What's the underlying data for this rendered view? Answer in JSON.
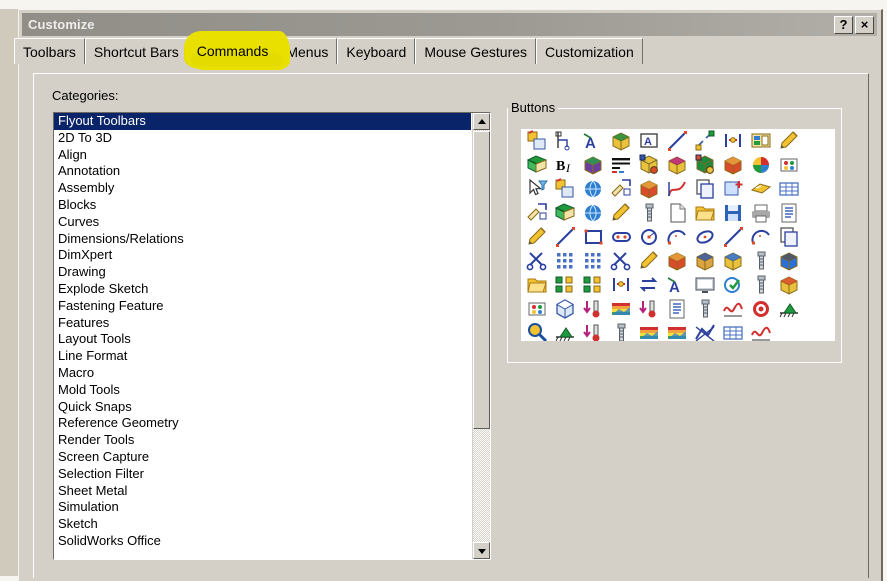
{
  "window": {
    "title": "Customize",
    "help_button": "?",
    "close_button": "×"
  },
  "tabs": [
    {
      "label": "Toolbars",
      "active": false
    },
    {
      "label": "Shortcut Bars",
      "active": false
    },
    {
      "label": "Commands",
      "active": true,
      "highlighted": true
    },
    {
      "label": "Menus",
      "active": false
    },
    {
      "label": "Keyboard",
      "active": false
    },
    {
      "label": "Mouse Gestures",
      "active": false
    },
    {
      "label": "Customization",
      "active": false
    }
  ],
  "categories": {
    "label": "Categories:",
    "selected": "Flyout Toolbars",
    "items": [
      "Flyout Toolbars",
      "2D To 3D",
      "Align",
      "Annotation",
      "Assembly",
      "Blocks",
      "Curves",
      "Dimensions/Relations",
      "DimXpert",
      "Drawing",
      "Explode Sketch",
      "Fastening Feature",
      "Features",
      "Layout Tools",
      "Line Format",
      "Macro",
      "Mold Tools",
      "Quick Snaps",
      "Reference Geometry",
      "Render Tools",
      "Screen Capture",
      "Selection Filter",
      "Sheet Metal",
      "Simulation",
      "Sketch",
      "SolidWorks Office"
    ]
  },
  "buttons_group": {
    "label": "Buttons",
    "icon_rows": [
      [
        "flyout-assembly-icon",
        "flyout-layout-tools-icon",
        "flyout-annotation-icon",
        "flyout-mold-tools-icon",
        "flyout-note-icon",
        "flyout-spline-icon",
        "flyout-explode-icon",
        "flyout-alignment-icon",
        "flyout-blocks-icon",
        "flyout-sketch-path-icon"
      ],
      [
        "flyout-reference-geometry-icon",
        "flyout-format-text-icon",
        "flyout-extrude-icon",
        "flyout-line-format-icon",
        "flyout-display-state-icon",
        "flyout-surfaces-icon",
        "flyout-view-icon",
        "flyout-weldments-icon",
        "flyout-appearance-icon",
        "flyout-simulation-icon"
      ],
      [
        "select-filter-icon",
        "component-properties-icon",
        "render-tools-icon",
        "measure-icon",
        "mold-cavity-icon",
        "curve-icon",
        "copy-icon",
        "new-part-icon",
        "highlight-surface-icon",
        "table-icon"
      ],
      [
        "sum-dimension-icon",
        "shaded-sketch-icon",
        "globe-render-icon",
        "axis-sketch-icon",
        "bolt-fastener-icon",
        "new-document-icon",
        "open-document-icon",
        "save-document-icon",
        "print-icon",
        "properties-list-icon"
      ],
      [
        "sketch-pencil-icon",
        "line-icon",
        "rectangle-icon",
        "slot-icon",
        "circle-icon",
        "arc-icon",
        "ellipse-icon",
        "spline-icon",
        "tangent-arc-icon",
        "offset-entities-icon"
      ],
      [
        "trim-entities-icon",
        "sketch-pattern-icon",
        "linear-pattern-icon",
        "split-entities-icon",
        "sketch-fillet-icon",
        "extrude-boss-icon",
        "extrude-cut-icon",
        "revolve-boss-icon",
        "hole-wizard-icon",
        "draft-icon"
      ],
      [
        "open-assembly-icon",
        "exploded-view-icon",
        "rotate-component-icon",
        "mate-icon",
        "swap-direction-icon",
        "text-size-icon",
        "display-screen-icon",
        "check-sketch-icon",
        "hardware-icon",
        "mold-design-icon"
      ],
      [
        "flow-simulation-icon",
        "iso-box-icon",
        "thermal-load-icon",
        "rainbow-plot-icon",
        "temperature-load-icon",
        "report-icon",
        "fasteners-icon",
        "frequency-plot-icon",
        "target-result-icon",
        "fixture-icon"
      ],
      [
        "zoom-icon",
        "restraint-icon",
        "thermal-icon",
        "spring-connector-icon",
        "rainbow-design-icon",
        "rainbow-surface-icon",
        "mesh-plot-icon",
        "fixture-grid-icon",
        "chart-result-icon"
      ]
    ]
  },
  "colors": {
    "dialog_face": "#d4d0c8",
    "titlebar": "#918e88",
    "selection": "#0a246a",
    "highlighter": "#e9e000",
    "panel_white": "#ffffff"
  }
}
